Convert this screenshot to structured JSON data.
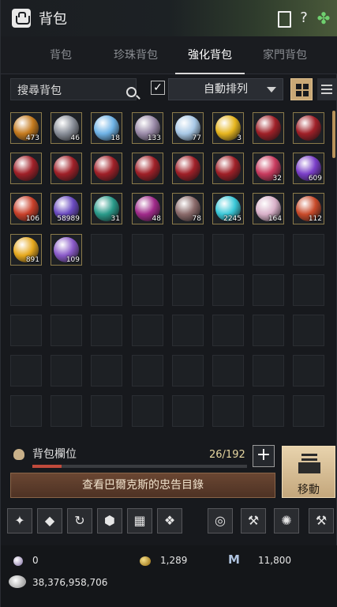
{
  "window": {
    "title": "背包"
  },
  "tabs": [
    {
      "label": "背包",
      "active": false
    },
    {
      "label": "珍珠背包",
      "active": false
    },
    {
      "label": "強化背包",
      "active": true
    },
    {
      "label": "家門背包",
      "active": false
    }
  ],
  "toolbar": {
    "search_placeholder": "搜尋背包",
    "auto_sort_checked": true,
    "sort_label": "自動排列"
  },
  "inventory": {
    "items": [
      {
        "name": "black-stone-armor",
        "count": "473",
        "color": "#c47a1e"
      },
      {
        "name": "black-stone-weapon",
        "count": "46",
        "color": "#8a8f99"
      },
      {
        "name": "concentrated-black-stone",
        "count": "18",
        "color": "#6fb3e6"
      },
      {
        "name": "sharp-crystal",
        "count": "133",
        "color": "#9a8aa8"
      },
      {
        "name": "hard-crystal",
        "count": "77",
        "color": "#a8c8e6"
      },
      {
        "name": "gold-bar",
        "count": "3",
        "color": "#e6b51e"
      },
      {
        "name": "red-crystal-1",
        "count": "",
        "color": "#a02028"
      },
      {
        "name": "red-crystal-2",
        "count": "",
        "color": "#a02028"
      },
      {
        "name": "red-crystal-3",
        "count": "",
        "color": "#a02028"
      },
      {
        "name": "red-crystal-4",
        "count": "",
        "color": "#a02028"
      },
      {
        "name": "red-crystal-5",
        "count": "",
        "color": "#a02028"
      },
      {
        "name": "red-crystal-6",
        "count": "",
        "color": "#a02028"
      },
      {
        "name": "red-crystal-7",
        "count": "",
        "color": "#a02028"
      },
      {
        "name": "red-crystal-8",
        "count": "",
        "color": "#a02028"
      },
      {
        "name": "caphras-red",
        "count": "32",
        "color": "#c83a5e"
      },
      {
        "name": "caphras-purple",
        "count": "609",
        "color": "#7a3ec8"
      },
      {
        "name": "flame-stone",
        "count": "106",
        "color": "#c8402a"
      },
      {
        "name": "spirit-stone",
        "count": "58989",
        "color": "#6a4ac0"
      },
      {
        "name": "teal-orb",
        "count": "31",
        "color": "#2a9a8a"
      },
      {
        "name": "galaxy-orb",
        "count": "48",
        "color": "#a02a8a"
      },
      {
        "name": "dark-shard",
        "count": "78",
        "color": "#8a6a6a"
      },
      {
        "name": "cyan-orb",
        "count": "2245",
        "color": "#3ac8d8"
      },
      {
        "name": "pearl-stone",
        "count": "164",
        "color": "#d8b0c8"
      },
      {
        "name": "red-ore",
        "count": "112",
        "color": "#c84a2a"
      },
      {
        "name": "amber-stone",
        "count": "891",
        "color": "#e6a81e"
      },
      {
        "name": "violet-shard",
        "count": "109",
        "color": "#8a5ac8"
      }
    ],
    "total_slots": 64
  },
  "capacity": {
    "label": "背包欄位",
    "count_text": "26/192",
    "used": 26,
    "max": 192
  },
  "buttons": {
    "advice": "查看巴爾克斯的忠告目錄",
    "move": "移動",
    "plus": "+"
  },
  "actions": [
    {
      "name": "enhance-wand-icon",
      "glyph": "✦"
    },
    {
      "name": "gem-fusion-icon",
      "glyph": "◆"
    },
    {
      "name": "cycle-icon",
      "glyph": "↻"
    },
    {
      "name": "hex-crystal-icon",
      "glyph": "⬢"
    },
    {
      "name": "grid-storage-icon",
      "glyph": "▦"
    },
    {
      "name": "repair-kit-icon",
      "glyph": "❖"
    },
    {
      "name": "target-icon",
      "glyph": "◎"
    },
    {
      "name": "axe-icon",
      "glyph": "⚒"
    },
    {
      "name": "swirl-icon",
      "glyph": "✺"
    },
    {
      "name": "hammer-icon",
      "glyph": "⚒"
    }
  ],
  "currency": {
    "pearls": "0",
    "gold_ingots": "1,289",
    "mileage": "11,800",
    "silver": "38,376,958,706",
    "m_glyph": "M"
  }
}
